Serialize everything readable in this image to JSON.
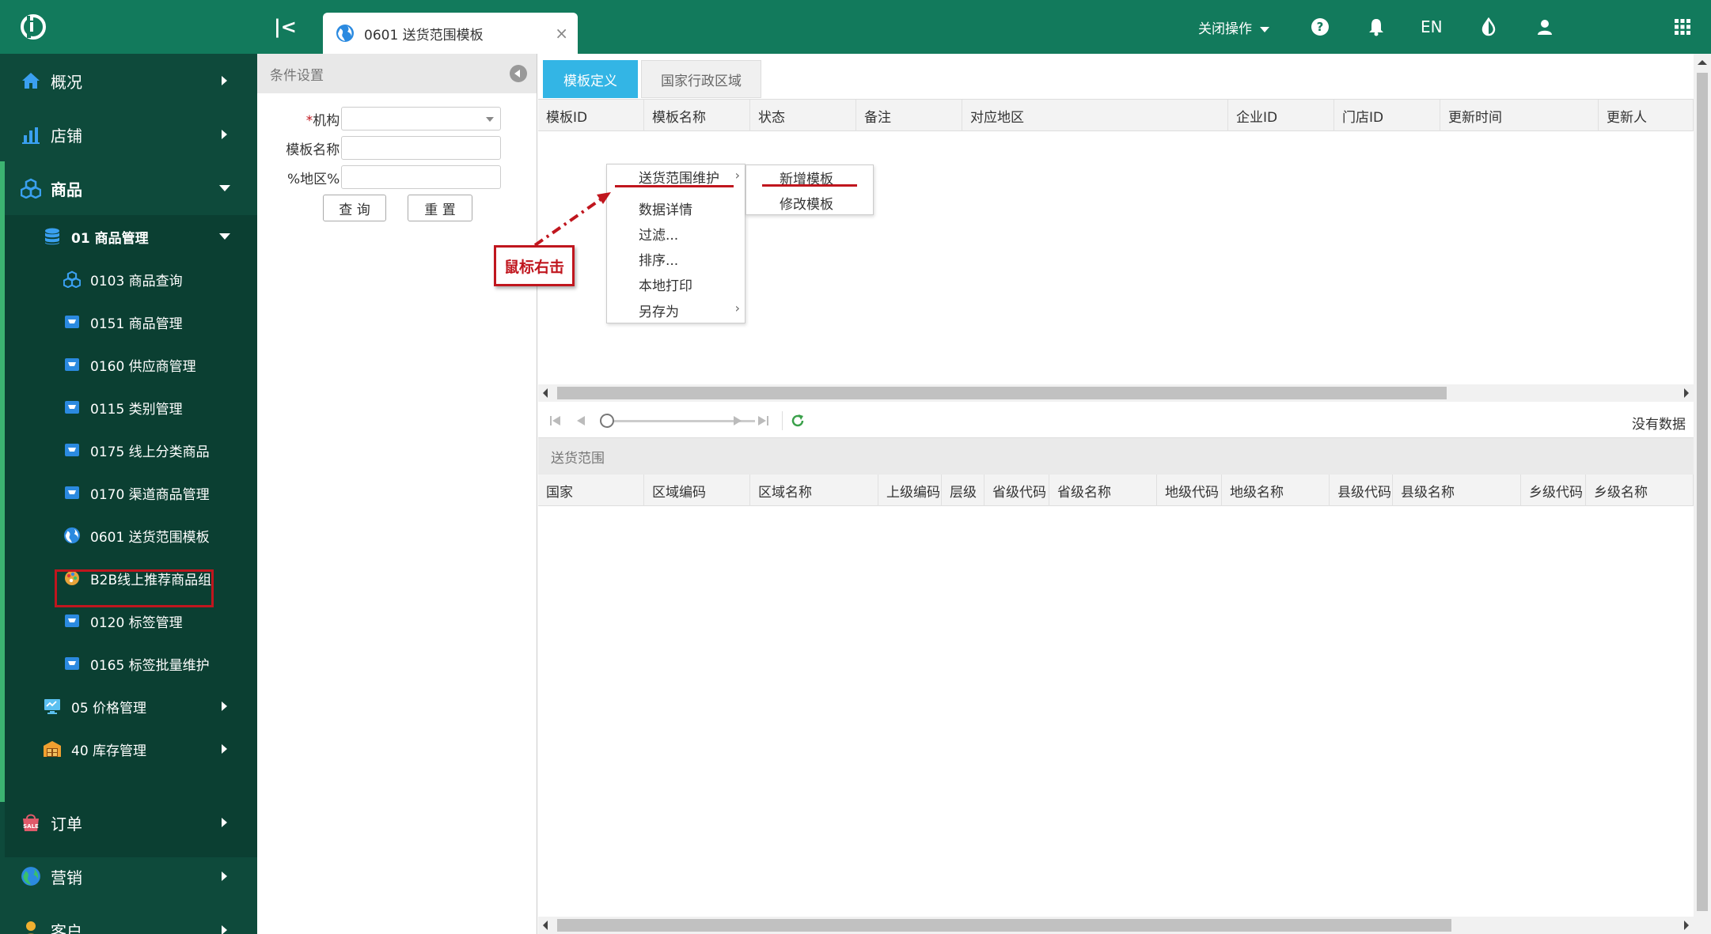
{
  "topbar": {
    "tab_title": "0601 送货范围模板",
    "close_ops": "关闭操作",
    "lang": "EN"
  },
  "sidebar": {
    "top_items": [
      {
        "label": "概况",
        "icon": "home-icon"
      },
      {
        "label": "店铺",
        "icon": "chart-icon"
      },
      {
        "label": "商品",
        "icon": "cubes-icon"
      }
    ],
    "group_head": "01 商品管理",
    "sub_items": [
      {
        "label": "0103 商品查询",
        "icon": "cubes-icon"
      },
      {
        "label": "0151 商品管理",
        "icon": "cart-icon"
      },
      {
        "label": "0160 供应商管理",
        "icon": "cart-icon"
      },
      {
        "label": "0115 类别管理",
        "icon": "cart-icon"
      },
      {
        "label": "0175 线上分类商品",
        "icon": "cart-icon"
      },
      {
        "label": "0170 渠道商品管理",
        "icon": "cart-icon"
      },
      {
        "label": "0601 送货范围模板",
        "icon": "globe-icon"
      },
      {
        "label": "B2B线上推荐商品组",
        "icon": "palette-icon"
      },
      {
        "label": "0120 标签管理",
        "icon": "cart-icon"
      },
      {
        "label": "0165 标签批量维护",
        "icon": "cart-icon"
      }
    ],
    "other_groups": [
      {
        "label": "05 价格管理",
        "icon": "monitor-icon"
      },
      {
        "label": "40 库存管理",
        "icon": "warehouse-icon"
      }
    ],
    "bottom_items": [
      {
        "label": "订单",
        "icon": "sale-icon"
      },
      {
        "label": "营销",
        "icon": "globe-icon"
      },
      {
        "label": "客户",
        "icon": "user-icon"
      }
    ]
  },
  "filter": {
    "title": "条件设置",
    "org_label": "机构:",
    "org_req": "*",
    "name_label": "模板名称:",
    "area_label": "%地区%:",
    "query_btn": "查 询",
    "reset_btn": "重 置"
  },
  "main": {
    "tab1": "模板定义",
    "tab2": "国家行政区域",
    "columns1": [
      "模板ID",
      "模板名称",
      "状态",
      "备注",
      "对应地区",
      "企业ID",
      "门店ID",
      "更新时间",
      "更新人"
    ],
    "no_data": "没有数据",
    "section2": "送货范围",
    "columns2": [
      "国家",
      "区域编码",
      "区域名称",
      "上级编码",
      "层级",
      "省级代码",
      "省级名称",
      "地级代码",
      "地级名称",
      "县级代码",
      "县级名称",
      "乡级代码",
      "乡级名称"
    ]
  },
  "context_menu": {
    "items": [
      "送货范围维护",
      "数据详情",
      "过滤...",
      "排序...",
      "本地打印",
      "另存为"
    ],
    "submenu": [
      "新增模板",
      "修改模板"
    ]
  },
  "annotation": {
    "callout": "鼠标右击"
  },
  "colors": {
    "topbar": "#127a5c",
    "sidebar": "#0e4a3b",
    "accent": "#33b5e5",
    "highlight": "#c0161e"
  }
}
